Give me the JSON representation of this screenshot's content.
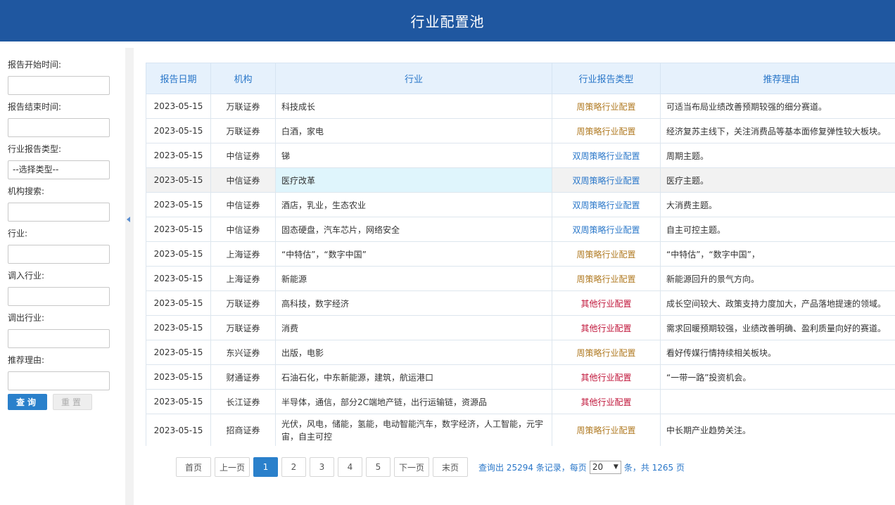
{
  "header": {
    "title": "行业配置池"
  },
  "sidebar": {
    "fields": [
      {
        "label": "报告开始时间:",
        "value": ""
      },
      {
        "label": "报告结束时间:",
        "value": ""
      },
      {
        "label": "行业报告类型:",
        "select_value": "--选择类型--"
      },
      {
        "label": "机构搜索:",
        "value": ""
      },
      {
        "label": "行业:",
        "value": ""
      },
      {
        "label": "调入行业:",
        "value": ""
      },
      {
        "label": "调出行业:",
        "value": ""
      },
      {
        "label": "推荐理由:",
        "value": ""
      }
    ],
    "query_label": "查询",
    "reset_label": "重置"
  },
  "table": {
    "columns": [
      "报告日期",
      "机构",
      "行业",
      "行业报告类型",
      "推荐理由"
    ],
    "rows": [
      {
        "date": "2023-05-15",
        "org": "万联证券",
        "industry": "科技成长",
        "type": "周策略行业配置",
        "reason": "可适当布局业绩改善预期较强的细分赛道。"
      },
      {
        "date": "2023-05-15",
        "org": "万联证券",
        "industry": "白酒，家电",
        "type": "周策略行业配置",
        "reason": "经济复苏主线下，关注消费品等基本面修复弹性较大板块。"
      },
      {
        "date": "2023-05-15",
        "org": "中信证券",
        "industry": "锑",
        "type": "双周策略行业配置",
        "reason": "周期主题。"
      },
      {
        "date": "2023-05-15",
        "org": "中信证券",
        "industry": "医疗改革",
        "type": "双周策略行业配置",
        "reason": "医疗主题。"
      },
      {
        "date": "2023-05-15",
        "org": "中信证券",
        "industry": "酒店，乳业，生态农业",
        "type": "双周策略行业配置",
        "reason": "大消费主题。"
      },
      {
        "date": "2023-05-15",
        "org": "中信证券",
        "industry": "固态硬盘，汽车芯片，网络安全",
        "type": "双周策略行业配置",
        "reason": "自主可控主题。"
      },
      {
        "date": "2023-05-15",
        "org": "上海证券",
        "industry": "“中特估”，“数字中国”",
        "type": "周策略行业配置",
        "reason": "“中特估”，“数字中国”，"
      },
      {
        "date": "2023-05-15",
        "org": "上海证券",
        "industry": "新能源",
        "type": "周策略行业配置",
        "reason": "新能源回升的景气方向。"
      },
      {
        "date": "2023-05-15",
        "org": "万联证券",
        "industry": "高科技，数字经济",
        "type": "其他行业配置",
        "reason": "成长空间较大、政策支持力度加大，产品落地提速的领域。"
      },
      {
        "date": "2023-05-15",
        "org": "万联证券",
        "industry": "消费",
        "type": "其他行业配置",
        "reason": "需求回暖预期较强，业绩改善明确、盈利质量向好的赛道。"
      },
      {
        "date": "2023-05-15",
        "org": "东兴证券",
        "industry": "出版，电影",
        "type": "周策略行业配置",
        "reason": "看好传媒行情持续相关板块。"
      },
      {
        "date": "2023-05-15",
        "org": "财通证券",
        "industry": "石油石化，中东新能源，建筑，航运港口",
        "type": "其他行业配置",
        "reason": "“一带一路”投资机会。"
      },
      {
        "date": "2023-05-15",
        "org": "长江证券",
        "industry": "半导体，通信，部分2C端地产链，出行运输链，资源品",
        "type": "其他行业配置",
        "reason": ""
      },
      {
        "date": "2023-05-15",
        "org": "招商证券",
        "industry": "光伏，风电，储能，氢能，电动智能汽车，数字经济，人工智能，元宇宙，自主可控",
        "type": "周策略行业配置",
        "reason": "中长期产业趋势关注。"
      }
    ]
  },
  "pagination": {
    "first": "首页",
    "prev": "上一页",
    "pages": [
      "1",
      "2",
      "3",
      "4",
      "5"
    ],
    "current": "1",
    "next": "下一页",
    "last": "末页",
    "summary_prefix": "查询出 25294 条记录，每页",
    "page_size": "20",
    "summary_suffix": "条，共 1265 页"
  },
  "colors": {
    "header_bg": "#1f57a0",
    "accent": "#2a80cb",
    "type_weekly": "#b07a22",
    "type_biweekly": "#2a77c9",
    "type_other": "#c0153a"
  }
}
